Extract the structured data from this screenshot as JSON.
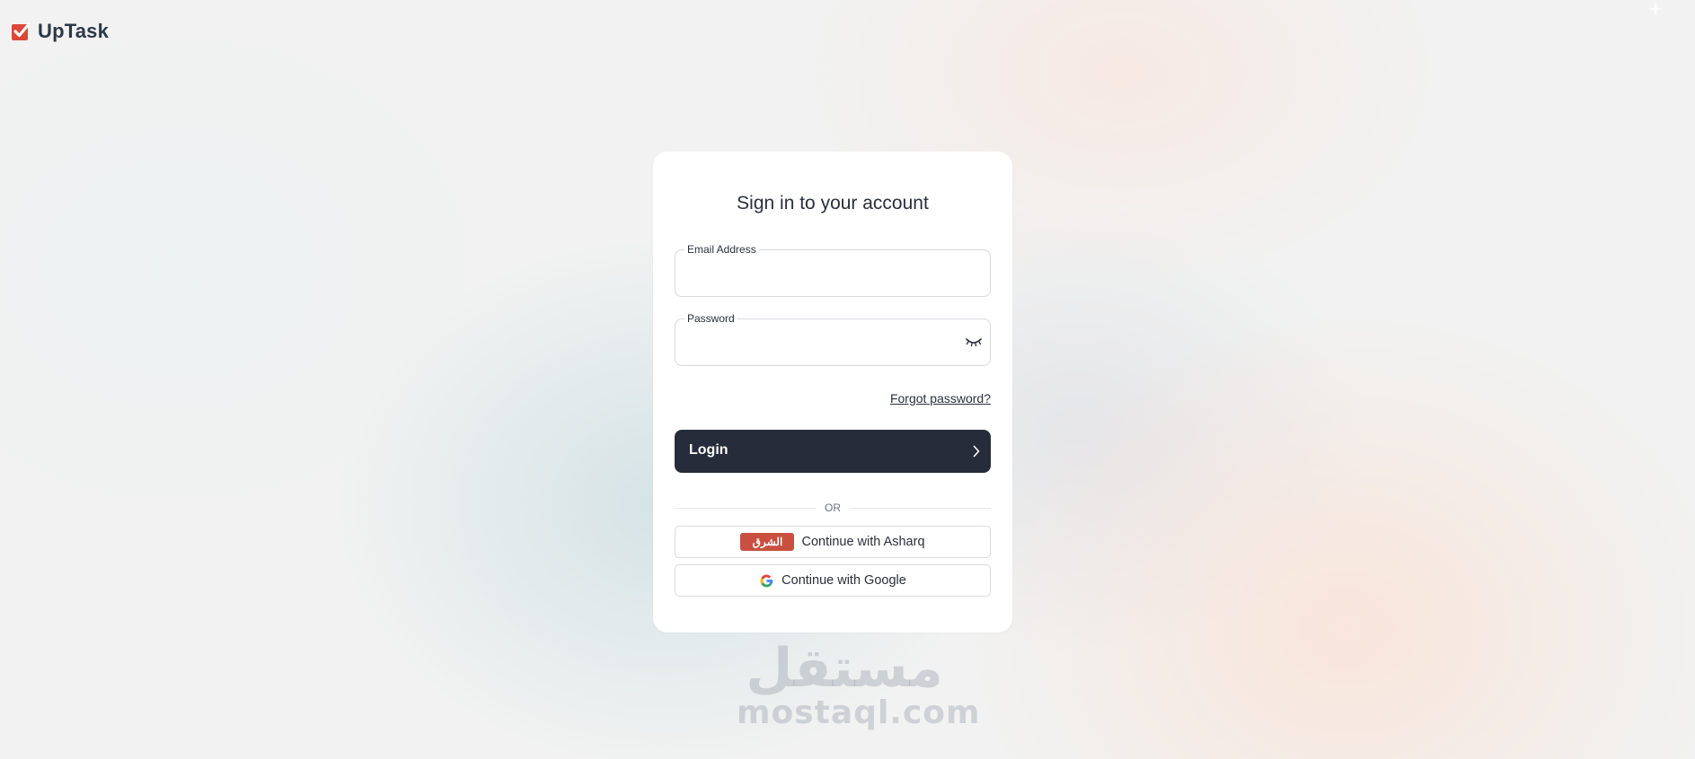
{
  "app": {
    "name": "UpTask"
  },
  "colors": {
    "accent": "#262c3a",
    "brand": "#d9483b",
    "asharq": "#c94f3f"
  },
  "signin": {
    "title": "Sign in to your account",
    "email": {
      "label": "Email Address",
      "value": "",
      "placeholder": ""
    },
    "password": {
      "label": "Password",
      "value": "",
      "placeholder": "",
      "toggle_icon": "eye-closed-icon"
    },
    "forgot_label": "Forgot password?",
    "login_label": "Login",
    "divider_label": "OR",
    "sso": {
      "asharq_badge": "الشرق",
      "asharq_label": "Continue with Asharq",
      "google_label": "Continue with Google"
    }
  },
  "watermark": {
    "arabic": "مستقل",
    "latin": "mostaql.com"
  }
}
